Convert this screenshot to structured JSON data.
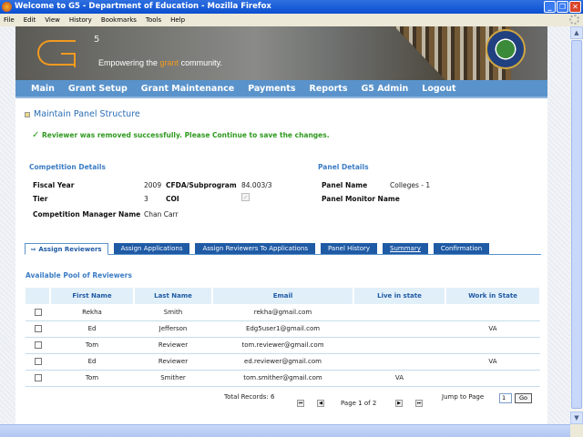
{
  "window": {
    "title": "Welcome to G5 - Department of Education - Mozilla Firefox",
    "menu": [
      "File",
      "Edit",
      "View",
      "History",
      "Bookmarks",
      "Tools",
      "Help"
    ]
  },
  "banner": {
    "logo": "G5",
    "tagline_pre": "Empowering the ",
    "tagline_accent": "grant",
    "tagline_post": " community."
  },
  "nav": [
    "Main",
    "Grant Setup",
    "Grant Maintenance",
    "Payments",
    "Reports",
    "G5 Admin",
    "Logout"
  ],
  "page_title": "Maintain Panel Structure",
  "message": "Reviewer was removed successfully. Please Continue to save the changes.",
  "competition": {
    "heading": "Competition Details",
    "fiscal_year_label": "Fiscal Year",
    "fiscal_year": "2009",
    "cfda_label": "CFDA/Subprogram",
    "cfda": "84.003/3",
    "tier_label": "Tier",
    "tier": "3",
    "coi_label": "COI",
    "coi_checked": true,
    "manager_label": "Competition Manager Name",
    "manager": "Chan Carr"
  },
  "panel": {
    "heading": "Panel Details",
    "name_label": "Panel Name",
    "name": "Colleges - 1",
    "monitor_label": "Panel Monitor Name"
  },
  "tabs": [
    "Assign Reviewers",
    "Assign Applications",
    "Assign Reviewers To Applications",
    "Panel History",
    "Summary",
    "Confirmation"
  ],
  "pool": {
    "heading": "Available Pool of Reviewers",
    "columns": [
      "First Name",
      "Last Name",
      "Email",
      "Live in state",
      "Work in State"
    ],
    "rows": [
      [
        "Rekha",
        "Smith",
        "rekha@gmail.com",
        "",
        ""
      ],
      [
        "Ed",
        "Jefferson",
        "Edg5user1@gmail.com",
        "",
        "VA"
      ],
      [
        "Tom",
        "Reviewer",
        "tom.reviewer@gmail.com",
        "",
        ""
      ],
      [
        "Ed",
        "Reviewer",
        "ed.reviewer@gmail.com",
        "",
        "VA"
      ],
      [
        "Tom",
        "Smither",
        "tom.smither@gmail.com",
        "VA",
        ""
      ]
    ]
  },
  "pager": {
    "total": "Total Records: 6",
    "page": "Page 1 of 2",
    "jump_label": "Jump to Page",
    "jump_value": "1",
    "go": "Go"
  }
}
